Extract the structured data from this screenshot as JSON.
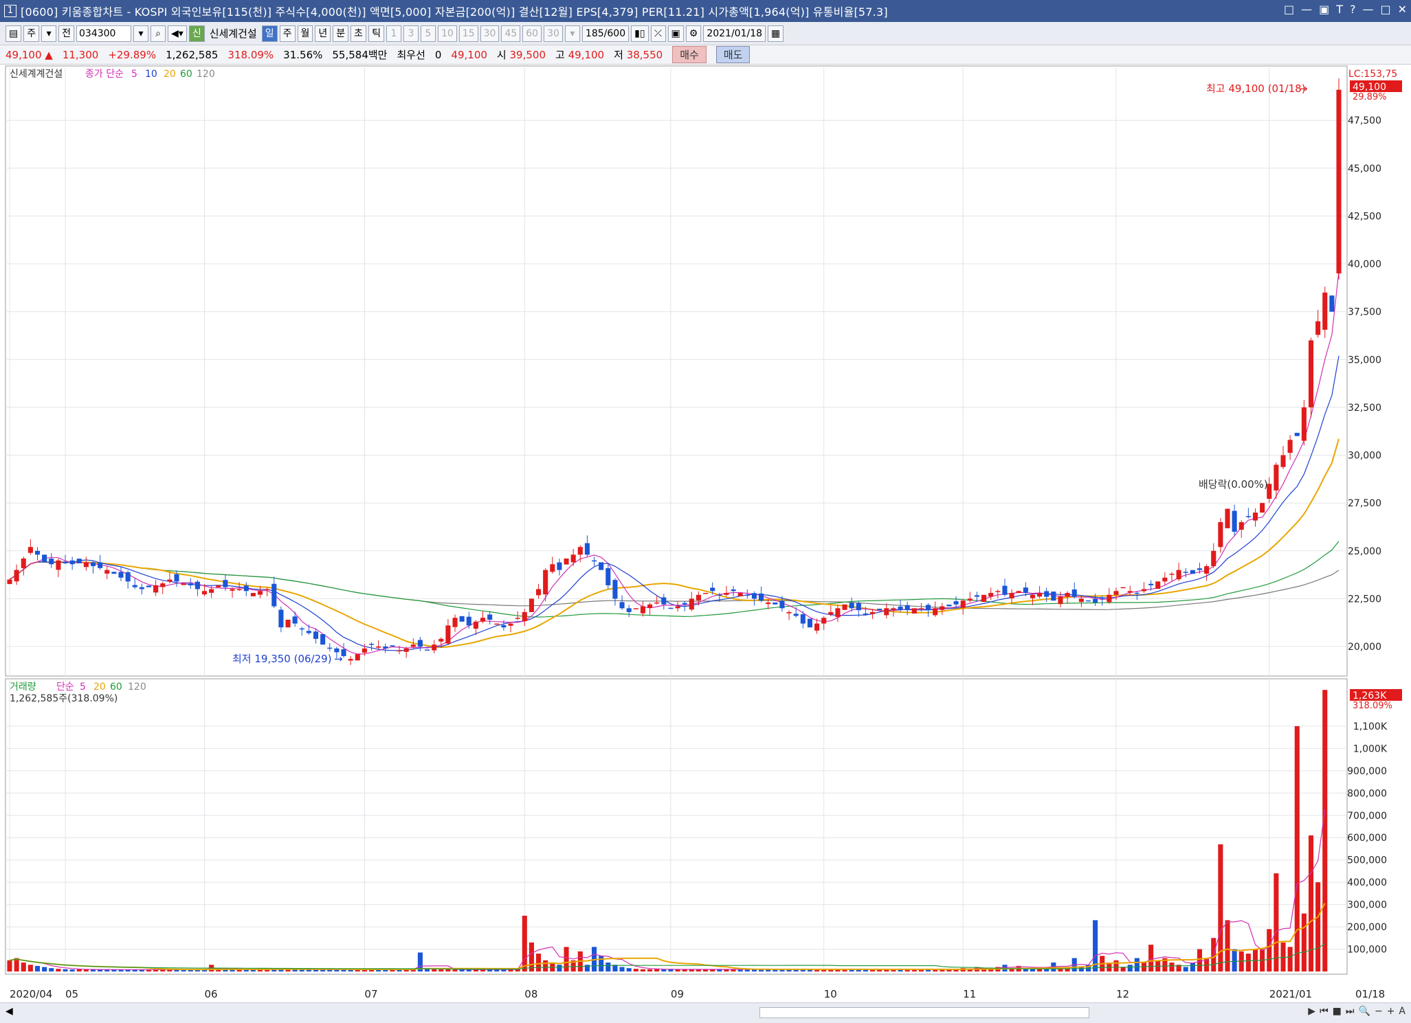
{
  "window": {
    "badge": "1",
    "title": "[0600] 키움종합차트 - KOSPI 외국인보유[115(천)] 주식수[4,000(천)] 액면[5,000] 자본금[200(억)] 결산[12월] EPS[4,379] PER[11.21] 시가총액[1,964(억)] 유통비율[57.3]",
    "controls": [
      "□",
      "—",
      "▣",
      "T",
      "?",
      "—",
      "□",
      "✕"
    ]
  },
  "toolbar": {
    "period_label": "주",
    "type_label": "전",
    "code": "034300",
    "shin_label": "신",
    "stock_name": "신세계건설",
    "period_tabs": [
      "일",
      "주",
      "월",
      "년",
      "분",
      "초",
      "틱"
    ],
    "active_tab": "일",
    "intervals": [
      "1",
      "3",
      "5",
      "10",
      "15",
      "30",
      "45",
      "60",
      "30"
    ],
    "count": "185",
    "count_total": "/600",
    "date": "2021/01/18"
  },
  "quote": {
    "price": "49,100",
    "change": "11,300",
    "change_pct": "+29.89%",
    "volume": "1,262,585",
    "vol_ratio": "318.09%",
    "turnover": "31.56%",
    "amount": "55,584백만",
    "priority_label": "최우선",
    "priority": "0",
    "bid": "49,100",
    "open_label": "시",
    "open": "39,500",
    "high_label": "고",
    "high": "49,100",
    "low_label": "저",
    "low": "38,550",
    "buy_label": "매수",
    "sell_label": "매도"
  },
  "price_panel": {
    "stock_label": "신세계계건설",
    "ma_label": "종가 단순",
    "ma_periods": [
      "5",
      "10",
      "20",
      "60",
      "120"
    ],
    "lc_label": "LC:153,75",
    "last_label": "49,100",
    "last_pct": "29.89%",
    "high_note": "최고 49,100 (01/18)",
    "low_note": "최저 19,350 (06/29)",
    "dividend_note": "배당락(0.00%)"
  },
  "volume_panel": {
    "title": "거래량",
    "ma_label": "단순",
    "ma_periods": [
      "5",
      "20",
      "60",
      "120"
    ],
    "current": "1,262,585주(318.09%)",
    "last_label": "1,263K",
    "last_pct": "318.09%"
  },
  "chart_data": {
    "type": "candlestick",
    "price_axis": {
      "ticks": [
        20000,
        22500,
        25000,
        27500,
        30000,
        32500,
        35000,
        37500,
        40000,
        42500,
        45000,
        47500
      ],
      "labels": [
        "20,000",
        "22,500",
        "25,000",
        "27,500",
        "30,000",
        "32,500",
        "35,000",
        "37,500",
        "40,000",
        "42,500",
        "45,000",
        "47,500"
      ],
      "ylim": [
        18600,
        50200
      ]
    },
    "volume_axis": {
      "ticks": [
        100000,
        200000,
        300000,
        400000,
        500000,
        600000,
        700000,
        800000,
        900000,
        1000000,
        1100000
      ],
      "labels": [
        "100,000",
        "200,000",
        "300,000",
        "400,000",
        "500,000",
        "600,000",
        "700,000",
        "800,000",
        "900,000",
        "1,000K",
        "1,100K"
      ],
      "ylim": [
        0,
        1300000
      ]
    },
    "x_labels": [
      {
        "label": "2020/04",
        "index": 0
      },
      {
        "label": "05",
        "index": 8
      },
      {
        "label": "06",
        "index": 28
      },
      {
        "label": "07",
        "index": 51
      },
      {
        "label": "08",
        "index": 74
      },
      {
        "label": "09",
        "index": 95
      },
      {
        "label": "10",
        "index": 117
      },
      {
        "label": "11",
        "index": 137
      },
      {
        "label": "12",
        "index": 159
      },
      {
        "label": "2021/01",
        "index": 181
      },
      {
        "label": "01/18",
        "index": 193
      }
    ],
    "closes": [
      23500,
      24000,
      24600,
      25200,
      24800,
      24400,
      24300,
      24500,
      24400,
      24300,
      24350,
      24400,
      24200,
      24100,
      24000,
      23800,
      23600,
      23400,
      23100,
      23000,
      23100,
      23200,
      23300,
      23500,
      23400,
      23300,
      23200,
      23000,
      22900,
      23000,
      23200,
      23100,
      23000,
      23000,
      22900,
      22800,
      22900,
      23000,
      22100,
      21000,
      21400,
      21200,
      20900,
      20700,
      20400,
      20100,
      19900,
      19700,
      19500,
      19350,
      19600,
      19900,
      20100,
      20000,
      19900,
      20000,
      19800,
      19900,
      20100,
      20000,
      19800,
      20100,
      20400,
      21100,
      21500,
      21300,
      21100,
      21300,
      21500,
      21400,
      21200,
      21000,
      21200,
      21500,
      21800,
      22500,
      23000,
      24000,
      24300,
      24000,
      24600,
      24800,
      25200,
      24800,
      24500,
      24000,
      23200,
      22500,
      22000,
      21800,
      22000,
      22100,
      22200,
      22300,
      22200,
      22000,
      22100,
      22200,
      22500,
      22700,
      22800,
      22900,
      22700,
      22800,
      22900,
      22800,
      22700,
      22500,
      22400,
      22300,
      22200,
      22000,
      21800,
      21600,
      21200,
      21000,
      21200,
      21500,
      21800,
      22000,
      22200,
      22000,
      21900,
      21700,
      21800,
      21900,
      22000,
      22000,
      21900,
      21900,
      22000,
      22000,
      21900,
      22000,
      22100,
      22100,
      22200,
      22400,
      22500,
      22600,
      22700,
      22800,
      22900,
      22700,
      22800,
      22900,
      22800,
      22700,
      22800,
      22600,
      22400,
      22600,
      22800,
      22600,
      22500,
      22400,
      22300,
      22500,
      22700,
      22900,
      23100,
      22900,
      22800,
      23000,
      23200,
      23400,
      23600,
      23800,
      24000,
      23900,
      23800,
      24000,
      24200,
      25000,
      26500,
      27200,
      26000,
      26500,
      26800,
      27000,
      27500,
      28500,
      29500,
      30000,
      30800,
      31000,
      32500,
      36000,
      37000,
      38500,
      37500,
      49100
    ],
    "volumes": [
      50000,
      60000,
      40000,
      30000,
      25000,
      20000,
      15000,
      12000,
      10000,
      9000,
      10000,
      9000,
      8000,
      9000,
      8500,
      8000,
      8000,
      8500,
      9000,
      7500,
      8000,
      8500,
      9000,
      9000,
      8500,
      9000,
      8000,
      8000,
      9000,
      30000,
      9000,
      9000,
      8500,
      9000,
      8500,
      9000,
      9000,
      8000,
      10000,
      12000,
      9000,
      9000,
      8500,
      9000,
      8500,
      9000,
      8000,
      9000,
      10000,
      12000,
      9000,
      9000,
      8500,
      9000,
      8000,
      9000,
      8000,
      8500,
      9000,
      85000,
      12000,
      10000,
      9000,
      9000,
      8500,
      9000,
      8000,
      8500,
      9000,
      8000,
      9000,
      8500,
      9000,
      12000,
      250000,
      130000,
      80000,
      50000,
      40000,
      30000,
      110000,
      50000,
      90000,
      30000,
      110000,
      70000,
      40000,
      30000,
      20000,
      15000,
      12000,
      10000,
      10000,
      12000,
      9000,
      10000,
      9000,
      10000,
      9000,
      10000,
      9000,
      10000,
      9000,
      10000,
      9000,
      10000,
      9000,
      10000,
      9000,
      10000,
      9000,
      10000,
      10000,
      9000,
      10000,
      9000,
      10000,
      9000,
      10000,
      9000,
      10000,
      9000,
      10000,
      9000,
      10000,
      9000,
      10000,
      9000,
      10000,
      9000,
      10000,
      9000,
      10000,
      9000,
      10000,
      9000,
      12000,
      15000,
      10000,
      20000,
      12000,
      15000,
      20000,
      30000,
      15000,
      25000,
      12000,
      15000,
      20000,
      20000,
      40000,
      20000,
      15000,
      60000,
      20000,
      30000,
      230000,
      70000,
      40000,
      50000,
      20000,
      30000,
      60000,
      40000,
      120000,
      50000,
      60000,
      40000,
      30000,
      20000,
      40000,
      100000,
      60000,
      150000,
      570000,
      230000,
      100000,
      90000,
      80000,
      100000,
      100000,
      190000,
      440000,
      130000,
      110000,
      1100000,
      260000,
      610000,
      400000,
      1262585
    ],
    "opens_delta_note": "open derived from close sequence"
  }
}
